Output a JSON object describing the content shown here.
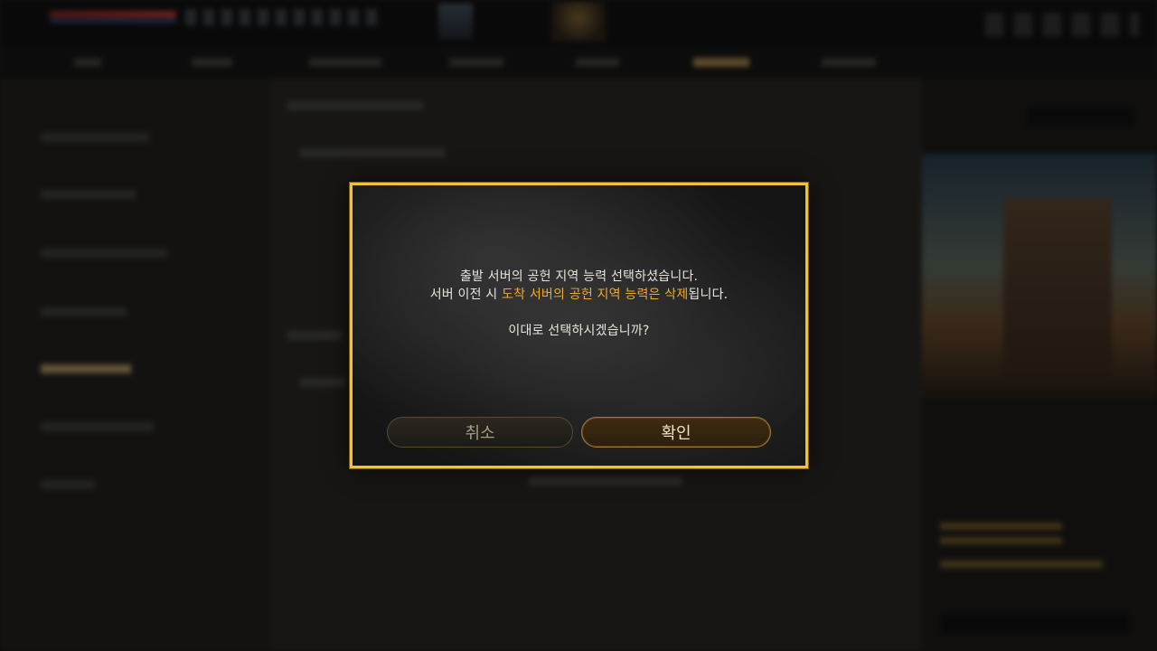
{
  "dialog": {
    "line1": "출발 서버의 공헌 지역 능력 선택하셨습니다.",
    "line2_prefix": "서버 이전 시 ",
    "line2_highlight": "도착 서버의 공헌 지역 능력은 삭제",
    "line2_suffix": "됩니다.",
    "line3": "이대로 선택하시겠습니까?",
    "cancel_label": "취소",
    "confirm_label": "확인"
  },
  "colors": {
    "dialog_border": "#f2c230",
    "highlight_text": "#f0a92c",
    "confirm_button_bg": "#3e2c12"
  }
}
